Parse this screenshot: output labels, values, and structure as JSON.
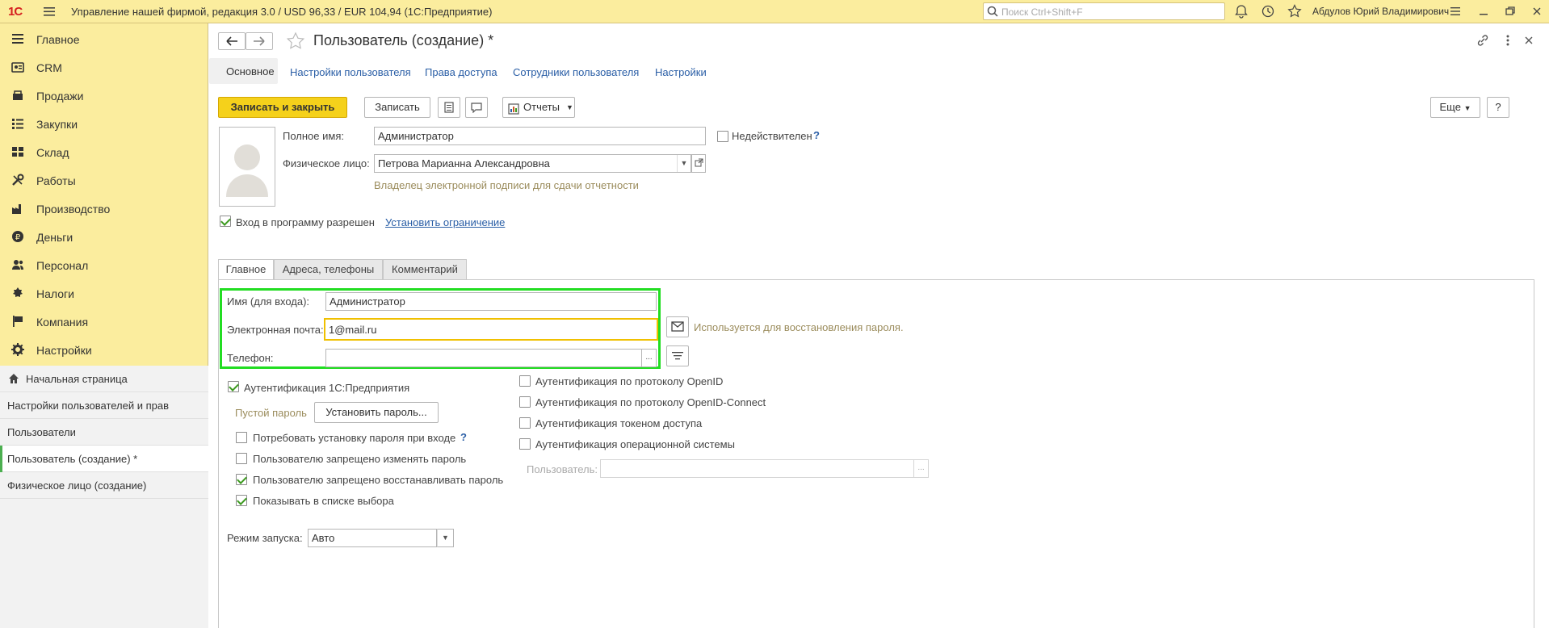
{
  "app": {
    "title": "Управление нашей фирмой, редакция 3.0 / USD 96,33 / EUR 104,94  (1С:Предприятие)",
    "logo_text": "1С",
    "search_placeholder": "Поиск Ctrl+Shift+F",
    "user_name": "Абдулов Юрий Владимирович"
  },
  "sidebar": {
    "items": [
      {
        "label": "Главное",
        "icon": "menu-lines-icon"
      },
      {
        "label": "CRM",
        "icon": "crm-icon"
      },
      {
        "label": "Продажи",
        "icon": "sales-icon"
      },
      {
        "label": "Закупки",
        "icon": "purchases-icon"
      },
      {
        "label": "Склад",
        "icon": "warehouse-icon"
      },
      {
        "label": "Работы",
        "icon": "tools-icon"
      },
      {
        "label": "Производство",
        "icon": "factory-icon"
      },
      {
        "label": "Деньги",
        "icon": "money-icon"
      },
      {
        "label": "Персонал",
        "icon": "people-icon"
      },
      {
        "label": "Налоги",
        "icon": "taxes-icon"
      },
      {
        "label": "Компания",
        "icon": "flag-icon"
      },
      {
        "label": "Настройки",
        "icon": "gear-icon"
      }
    ],
    "open_windows": [
      {
        "label": "Начальная страница"
      },
      {
        "label": "Настройки пользователей и прав"
      },
      {
        "label": "Пользователи"
      },
      {
        "label": "Пользователь (создание) *"
      },
      {
        "label": "Физическое лицо (создание)"
      }
    ]
  },
  "form": {
    "title": "Пользователь (создание) *",
    "nav_tabs": [
      "Основное",
      "Настройки пользователя",
      "Права доступа",
      "Сотрудники пользователя",
      "Настройки"
    ],
    "toolbar": {
      "save_close": "Записать и закрыть",
      "save": "Записать",
      "reports": "Отчеты",
      "more": "Еще",
      "help": "?"
    },
    "full_name_label": "Полное имя:",
    "full_name_value": "Администратор",
    "invalid_label": "Недействителен",
    "help_mark": "?",
    "person_label": "Физическое лицо:",
    "person_value": "Петрова Марианна Александровна",
    "signature_note": "Владелец электронной подписи для сдачи отчетности",
    "login_allowed": "Вход в программу разрешен",
    "set_restriction": "Установить ограничение",
    "tabs": [
      "Главное",
      "Адреса, телефоны",
      "Комментарий"
    ],
    "login_name_label": "Имя (для входа):",
    "login_name_value": "Администратор",
    "email_label": "Электронная почта:",
    "email_value": "1@mail.ru",
    "email_note": "Используется для восстановления пароля.",
    "phone_label": "Телефон:",
    "phone_value": "",
    "ellipsis": "...",
    "auth_1c": "Аутентификация 1С:Предприятия",
    "empty_password": "Пустой пароль",
    "set_password": "Установить пароль...",
    "require_password": "Потребовать установку пароля при входе",
    "forbid_change": "Пользователю запрещено изменять пароль",
    "forbid_restore": "Пользователю запрещено восстанавливать пароль",
    "show_in_list": "Показывать в списке выбора",
    "auth_openid": "Аутентификация по протоколу OpenID",
    "auth_openid_connect": "Аутентификация по протоколу OpenID-Connect",
    "auth_token": "Аутентификация токеном доступа",
    "auth_os": "Аутентификация операционной системы",
    "os_user_label": "Пользователь:",
    "os_user_value": "",
    "run_mode_label": "Режим запуска:",
    "run_mode_value": "Авто"
  },
  "colors": {
    "panel": "#fbed9e",
    "primary_button": "#f5d11b",
    "highlight": "#22dd22",
    "focus": "#f0c000",
    "link": "#2a5ea6"
  }
}
